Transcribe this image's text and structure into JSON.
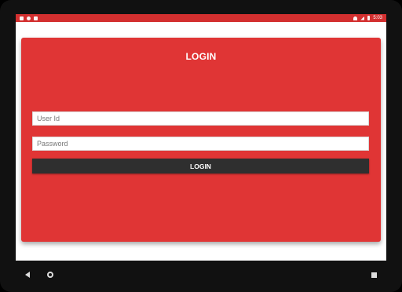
{
  "statusbar": {
    "time": "5:03",
    "icons_left": [
      "notification-icon",
      "sync-icon",
      "sd-card-icon"
    ],
    "icons_right": [
      "wifi-icon",
      "signal-icon",
      "battery-icon"
    ]
  },
  "login_card": {
    "title": "LOGIN",
    "user_id_placeholder": "User Id",
    "password_placeholder": "Password",
    "button_label": "LOGIN"
  },
  "colors": {
    "status_bar": "#d32f2f",
    "card": "#e03535",
    "button": "#2f2f2f"
  }
}
